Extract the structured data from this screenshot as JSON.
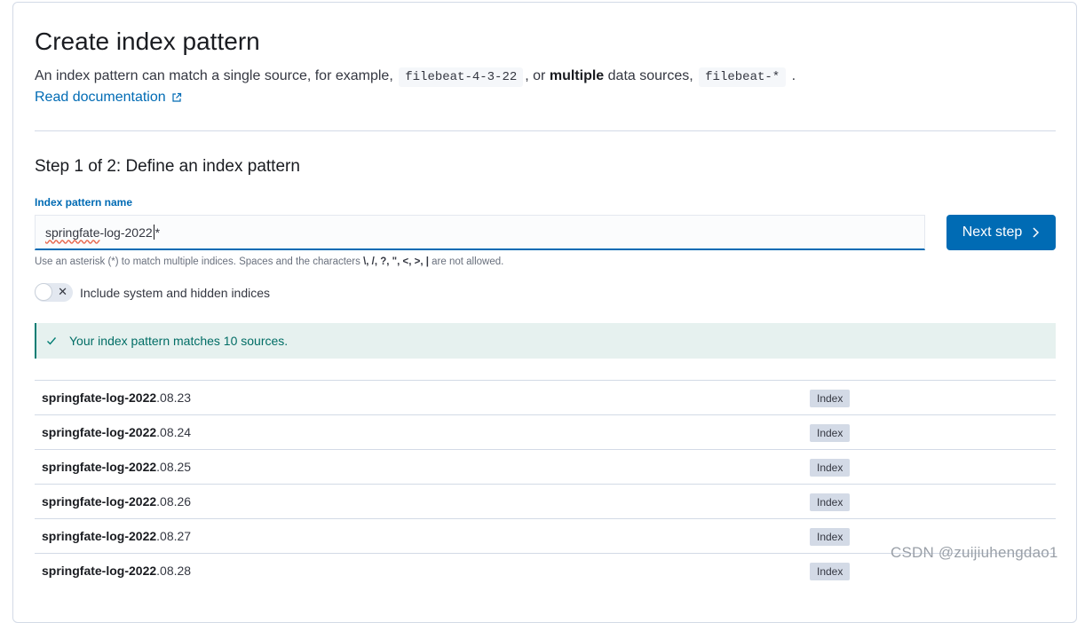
{
  "page": {
    "title": "Create index pattern",
    "description_part1": "An index pattern can match a single source, for example,",
    "example_single": "filebeat-4-3-22",
    "description_part2": ", or",
    "description_bold": "multiple",
    "description_part3": "data sources,",
    "example_multiple": "filebeat-*",
    "description_end": ".",
    "read_docs_label": "Read documentation",
    "read_docs_icon": "popout-icon"
  },
  "step": {
    "title": "Step 1 of 2: Define an index pattern",
    "field_label": "Index pattern name",
    "input_value_underlined": "springfate",
    "input_value_rest": "-log-2022",
    "input_value_after_caret": "*",
    "next_button_label": "Next step",
    "next_button_icon": "chevron-right-icon",
    "help_prefix": "Use an asterisk (*) to match multiple indices. Spaces and the characters",
    "help_chars": "\\, /, ?, \", <, >, |",
    "help_suffix": "are not allowed.",
    "toggle_label": "Include system and hidden indices",
    "toggle_on": false,
    "callout_text": "Your index pattern matches 10 sources.",
    "callout_icon": "check-icon"
  },
  "matches": [
    {
      "prefix": "springfate-log-2022",
      "suffix": ".08.23",
      "type": "Index"
    },
    {
      "prefix": "springfate-log-2022",
      "suffix": ".08.24",
      "type": "Index"
    },
    {
      "prefix": "springfate-log-2022",
      "suffix": ".08.25",
      "type": "Index"
    },
    {
      "prefix": "springfate-log-2022",
      "suffix": ".08.26",
      "type": "Index"
    },
    {
      "prefix": "springfate-log-2022",
      "suffix": ".08.27",
      "type": "Index"
    },
    {
      "prefix": "springfate-log-2022",
      "suffix": ".08.28",
      "type": "Index"
    }
  ],
  "watermark": "CSDN @zuijiuhengdao1",
  "colors": {
    "primary": "#006bb4",
    "success": "#017d73",
    "callout_bg": "#e6f1ef",
    "badge_bg": "#d3dae6"
  }
}
